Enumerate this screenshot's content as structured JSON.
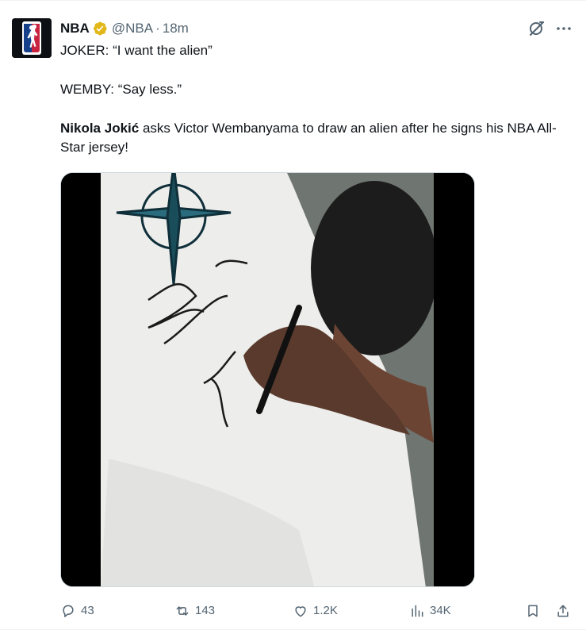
{
  "post": {
    "author_name": "NBA",
    "handle": "@NBA",
    "separator": "·",
    "time": "18m",
    "avatar_text": "NBA",
    "lines": {
      "line1": "JOKER: “I want the alien”",
      "line2": "WEMBY: “Say less.”",
      "line3_bold": "Nikola Jokić",
      "line3_rest": " asks Victor Wembanyama to draw an alien after he signs his NBA All-Star jersey!"
    }
  },
  "media": {
    "description_icon": "video-frame"
  },
  "actions": {
    "replies": "43",
    "reposts": "143",
    "likes": "1.2K",
    "views": "34K"
  },
  "icons": {
    "verified": "verified-gold-badge-icon",
    "grok": "grok-icon",
    "more": "more-horizontal-icon",
    "reply": "reply-bubble-icon",
    "repost": "repost-arrows-icon",
    "like": "heart-icon",
    "views": "views-bars-icon",
    "bookmark": "bookmark-icon",
    "share": "share-upload-icon"
  },
  "colors": {
    "text": "#0f1419",
    "muted": "#536471",
    "verified_gold": "#e2b719",
    "nba_red": "#c9243f",
    "nba_blue": "#17408b"
  }
}
